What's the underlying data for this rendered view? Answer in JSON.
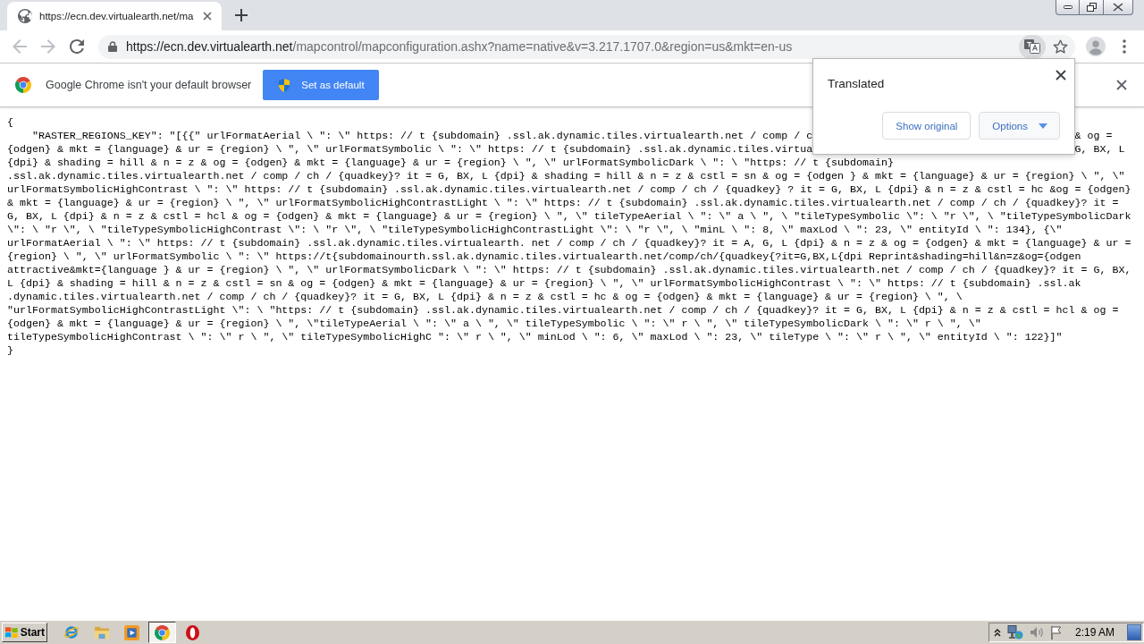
{
  "tab_strip": {
    "tabs": [
      {
        "title": "https://ecn.dev.virtualearth.net/ma",
        "selected": true
      }
    ]
  },
  "toolbar": {
    "nav": [
      {
        "kind": "back",
        "disabled": true
      },
      {
        "kind": "forward",
        "disabled": true
      },
      {
        "kind": "reload",
        "disabled": false
      }
    ],
    "address": {
      "host": "https://ecn.dev.virtualearth.net",
      "path": "/mapcontrol/mapconfiguration.ashx?name=native&v=3.217.1707.0&region=us&mkt=en-us"
    },
    "translate_active": true
  },
  "infobar": {
    "message": "Google Chrome isn't your default browser",
    "button": "Set as default"
  },
  "page": {
    "open_brace": "{",
    "entries": [
      {
        "lines": [
          {
            "segments": [
              "\"RASTER_REGIONS_KEY\": \"[{{\" urlFormatAerial \\ \": \\\" https: // t {subdomain} .ssl.ak.dynamic.tiles.virtualearth.net / comp / c",
              "& og ="
            ]
          },
          {
            "segments": [
              "{odgen} & mkt = {language} & ur = {region} \\ \", \\\" urlFormatSymbolic \\ \": \\\" https: // t {subdomain} .ssl.ak.dynamic.tiles.virtua",
              "G, BX, L"
            ]
          },
          {
            "segments": [
              "{dpi} & shading = hill & n = z & og = {odgen} & mkt = {language} & ur = {region} \\ \", \\\" urlFormatSymbolicDark \\ \": \\ \"https: // t {subdomain}"
            ]
          },
          {
            "segments": [
              ".ssl.ak.dynamic.tiles.virtualearth.net / comp / ch / {quadkey}? it = G, BX, L {dpi} & shading = hill & n = z & cstl = sn & og = {odgen } & mkt = {language} & ur = {region} \\ \", \\\""
            ]
          },
          {
            "segments": [
              "urlFormatSymbolicHighContrast \\ \": \\\" https: // t {subdomain} .ssl.ak.dynamic.tiles.virtualearth.net / comp / ch / {quadkey} ? it = G, BX, L {dpi} & n = z & cstl = hc &og = {odgen}"
            ]
          },
          {
            "segments": [
              "& mkt = {language} & ur = {region} \\ \", \\\" urlFormatSymbolicHighContrastLight \\ \": \\\" https: // t {subdomain} .ssl.ak.dynamic.tiles.virtualearth.net / comp / ch / {quadkey}? it ="
            ]
          },
          {
            "segments": [
              "G, BX, L {dpi} & n = z & cstl = hcl & og = {odgen} & mkt = {language} & ur = {region} \\ \", \\\" tileTypeAerial \\ \": \\\" a \\ \", \\ \"tileTypeSymbolic \\\": \\ \"r \\\", \\ \"tileTypeSymbolicDark"
            ]
          },
          {
            "segments": [
              "\\\": \\ \"r \\\", \\ \"tileTypeSymbolicHighContrast \\\": \\ \"r \\\", \\ \"tileTypeSymbolicHighContrastLight \\\": \\ \"r \\\", \\ \"minL \\ \": 8, \\\" maxLod \\ \": 23, \\\" entityId \\ \": 134}, {\\\""
            ]
          },
          {
            "segments": [
              "urlFormatAerial \\ \": \\\" https: // t {subdomain} .ssl.ak.dynamic.tiles.virtualearth. net / comp / ch / {quadkey}? it = A, G, L {dpi} & n = z & og = {odgen} & mkt = {language} & ur ="
            ]
          },
          {
            "segments": [
              "{region} \\ \", \\\" urlFormatSymbolic \\ \": \\\" https://t{subdomainourth.ssl.ak.dynamic.tiles.virtualearth.net/comp/ch/{quadkey{?it=G,BX,L{dpi Reprint&shading=hill&n=z&og={odgen"
            ]
          },
          {
            "segments": [
              "attractive&mkt={language } & ur = {region} \\ \", \\\" urlFormatSymbolicDark \\ \": \\\" https: // t {subdomain} .ssl.ak.dynamic.tiles.virtualearth.net / comp / ch / {quadkey}? it = G, BX,"
            ]
          },
          {
            "segments": [
              "L {dpi} & shading = hill & n = z & cstl = sn & og = {odgen} & mkt = {language} & ur = {region} \\ \", \\\" urlFormatSymbolicHighContrast \\ \": \\\" https: // t {subdomain} .ssl.ak"
            ]
          },
          {
            "segments": [
              ".dynamic.tiles.virtualearth.net / comp / ch / {quadkey}? it = G, BX, L {dpi} & n = z & cstl = hc & og = {odgen} & mkt = {language} & ur = {region} \\ \", \\"
            ]
          },
          {
            "segments": [
              "\"urlFormatSymbolicHighContrastLight \\\": \\ \"https: // t {subdomain} .ssl.ak.dynamic.tiles.virtualearth.net / comp / ch / {quadkey}? it = G, BX, L {dpi} & n = z & cstl = hcl & og ="
            ]
          },
          {
            "segments": [
              "{odgen} & mkt = {language} & ur = {region} \\ \", \\\"tileTypeAerial \\ \": \\\" a \\ \", \\\" tileTypeSymbolic \\ \": \\\" r \\ \", \\\" tileTypeSymbolicDark \\ \": \\\" r \\ \", \\\""
            ]
          },
          {
            "segments": [
              "tileTypeSymbolicHighContrast \\ \": \\\" r \\ \", \\\" tileTypeSymbolicHighC \": \\\" r \\ \", \\\" minLod \\ \": 6, \\\" maxLod \\ \": 23, \\\" tileType \\ \": \\\" r \\ \", \\\" entityId \\ \": 122}]\""
            ]
          }
        ]
      }
    ],
    "close_brace": "}"
  },
  "translate_popup": {
    "title": "Translated",
    "buttons": [
      {
        "label": "Show original",
        "kind": "plain"
      },
      {
        "label": "Options",
        "kind": "menu"
      }
    ]
  },
  "taskbar": {
    "start": "Start",
    "apps": [
      {
        "kind": "e_browser",
        "selected": false
      },
      {
        "kind": "folder",
        "selected": false
      },
      {
        "kind": "player",
        "selected": false
      },
      {
        "kind": "chrome",
        "selected": true
      },
      {
        "kind": "o_browser",
        "selected": false
      }
    ],
    "clock": "2:19 AM"
  }
}
